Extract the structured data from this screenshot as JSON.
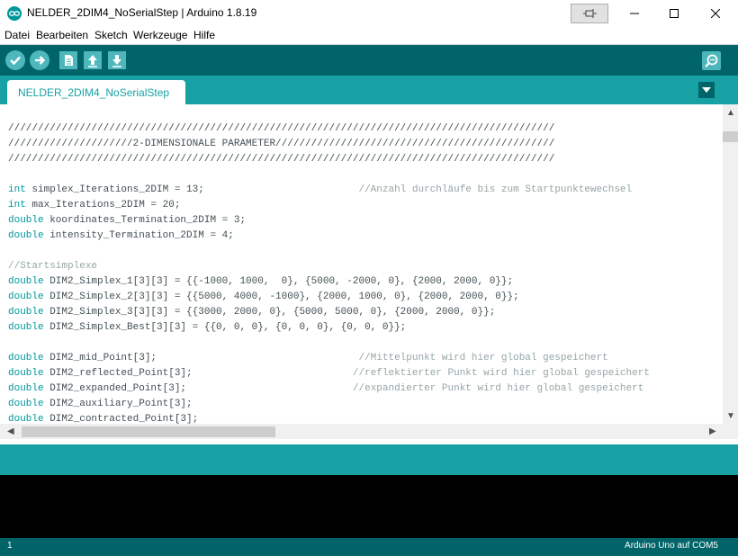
{
  "window": {
    "title": "NELDER_2DIM4_NoSerialStep | Arduino 1.8.19"
  },
  "menu": [
    "Datei",
    "Bearbeiten",
    "Sketch",
    "Werkzeuge",
    "Hilfe"
  ],
  "toolbar": {
    "verify_icon": "check-icon",
    "upload_icon": "arrow-right-icon",
    "new_icon": "file-icon",
    "open_icon": "arrow-up-icon",
    "save_icon": "arrow-down-icon",
    "serial_monitor_icon": "magnifier-icon"
  },
  "tabs": [
    {
      "label": "NELDER_2DIM4_NoSerialStep",
      "active": true
    }
  ],
  "editor": {
    "lines": [
      {
        "kw": "",
        "code": "////////////////////////////////////////////////////////////////////////////////////////////",
        "comment": ""
      },
      {
        "kw": "",
        "code": "/////////////////////2-DIMENSIONALE PARAMETER///////////////////////////////////////////////",
        "comment": ""
      },
      {
        "kw": "",
        "code": "////////////////////////////////////////////////////////////////////////////////////////////",
        "comment": ""
      },
      {
        "kw": "",
        "code": "",
        "comment": ""
      },
      {
        "kw": "int",
        "code": " simplex_Iterations_2DIM = 13;                          ",
        "comment": "//Anzahl durchläufe bis zum Startpunktewechsel"
      },
      {
        "kw": "int",
        "code": " max_Iterations_2DIM = 20;",
        "comment": ""
      },
      {
        "kw": "double",
        "code": " koordinates_Termination_2DIM = 3;",
        "comment": ""
      },
      {
        "kw": "double",
        "code": " intensity_Termination_2DIM = 4;",
        "comment": ""
      },
      {
        "kw": "",
        "code": "",
        "comment": ""
      },
      {
        "kw": "",
        "code": "",
        "comment": "//Startsimplexe"
      },
      {
        "kw": "double",
        "code": " DIM2_Simplex_1[3][3] = {{-1000, 1000,  0}, {5000, -2000, 0}, {2000, 2000, 0}};",
        "comment": ""
      },
      {
        "kw": "double",
        "code": " DIM2_Simplex_2[3][3] = {{5000, 4000, -1000}, {2000, 1000, 0}, {2000, 2000, 0}};",
        "comment": ""
      },
      {
        "kw": "double",
        "code": " DIM2_Simplex_3[3][3] = {{3000, 2000, 0}, {5000, 5000, 0}, {2000, 2000, 0}};",
        "comment": ""
      },
      {
        "kw": "double",
        "code": " DIM2_Simplex_Best[3][3] = {{0, 0, 0}, {0, 0, 0}, {0, 0, 0}};",
        "comment": ""
      },
      {
        "kw": "",
        "code": "",
        "comment": ""
      },
      {
        "kw": "double",
        "code": " DIM2_mid_Point[3];                                  ",
        "comment": "//Mittelpunkt wird hier global gespeichert"
      },
      {
        "kw": "double",
        "code": " DIM2_reflected_Point[3];                           ",
        "comment": "//reflektierter Punkt wird hier global gespeichert"
      },
      {
        "kw": "double",
        "code": " DIM2_expanded_Point[3];                            ",
        "comment": "//expandierter Punkt wird hier global gespeichert"
      },
      {
        "kw": "double",
        "code": " DIM2_auxiliary_Point[3];",
        "comment": ""
      },
      {
        "kw": "double",
        "code": " DIM2_contracted_Point[3];",
        "comment": ""
      }
    ]
  },
  "status": {
    "line_number": "1",
    "board": "Arduino Uno auf COM5"
  }
}
